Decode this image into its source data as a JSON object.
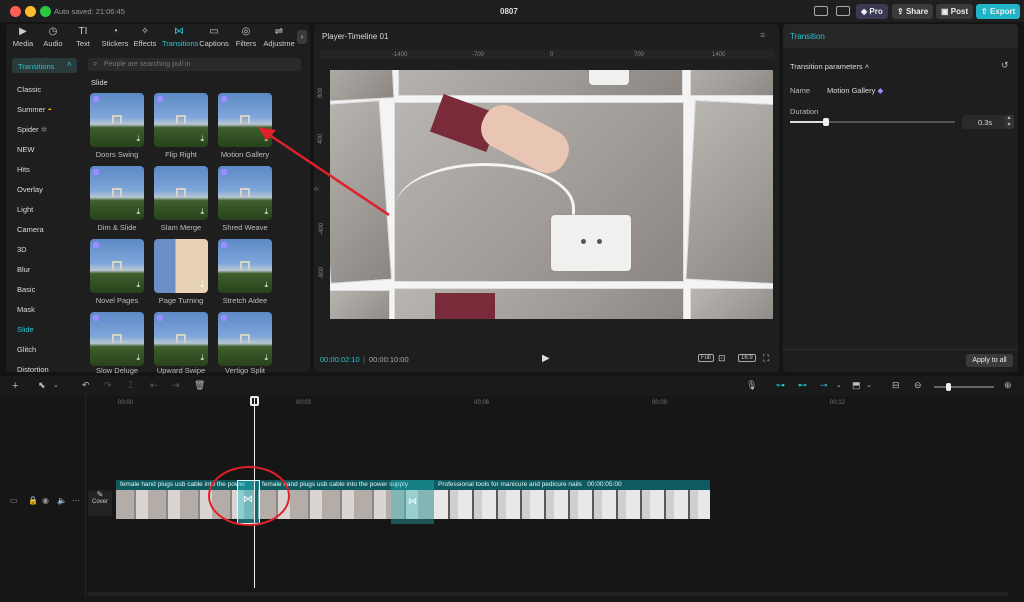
{
  "window": {
    "autosave": "Auto saved: 21:06:45",
    "title": "0807"
  },
  "top_right": {
    "pro": "Pro",
    "share": "Share",
    "post": "Post",
    "export": "Export"
  },
  "toolbar": [
    {
      "label": "Media",
      "icon": "media-icon"
    },
    {
      "label": "Audio",
      "icon": "audio-icon"
    },
    {
      "label": "Text",
      "icon": "text-icon"
    },
    {
      "label": "Stickers",
      "icon": "stickers-icon"
    },
    {
      "label": "Effects",
      "icon": "effects-icon"
    },
    {
      "label": "Transitions",
      "icon": "transitions-icon"
    },
    {
      "label": "Captions",
      "icon": "captions-icon"
    },
    {
      "label": "Filters",
      "icon": "filters-icon"
    },
    {
      "label": "Adjustme",
      "icon": "adjustment-icon"
    }
  ],
  "sidebar": {
    "header": "Transitions",
    "items": [
      "Classic",
      "Summer",
      "Spider",
      "NEW",
      "Hits",
      "Overlay",
      "Light",
      "Camera",
      "3D",
      "Blur",
      "Basic",
      "Mask",
      "Slide",
      "Glitch",
      "Distortion"
    ],
    "active": "Slide"
  },
  "search": {
    "placeholder": "People are searching pull in"
  },
  "section": "Slide",
  "transitions": [
    "Doors Swing",
    "Flip Right",
    "Motion Gallery",
    "Dim & Slide",
    "Slam Merge",
    "Shred Weave",
    "Novel Pages",
    "Page Turning",
    "Stretch Aidee",
    "Slow Deluge",
    "Upward Swipe",
    "Vertigo Split"
  ],
  "player": {
    "title": "Player-Timeline 01",
    "ruler_top": [
      "-1400",
      "-700",
      "0",
      "700",
      "1400"
    ],
    "ruler_left": [
      "800",
      "400",
      "0",
      "-400",
      "-800"
    ],
    "current_time": "00:00:02:10",
    "total_time": "00:00:10:00",
    "full_label": "Full",
    "ratio": "16:9"
  },
  "inspector": {
    "title": "Transition",
    "section": "Transition parameters",
    "name_label": "Name",
    "name_value": "Motion Gallery",
    "duration_label": "Duration",
    "duration_value": "0.3s",
    "duration_fraction": 0.22,
    "apply_all": "Apply to all"
  },
  "timeline": {
    "ticks": [
      "00:00",
      "00:03",
      "00:06",
      "00:09",
      "00:12"
    ],
    "cover_label": "Cover",
    "clips": [
      {
        "title": "female hand plugs usb cable into the power"
      },
      {
        "title": "female hand plugs usb cable into the power supply"
      },
      {
        "title": "Professional tools for manicure and pedicure nails",
        "duration": "00:00:05:00"
      }
    ]
  },
  "colors": {
    "accent": "#27c6d2",
    "annotation": "#e0202a"
  }
}
